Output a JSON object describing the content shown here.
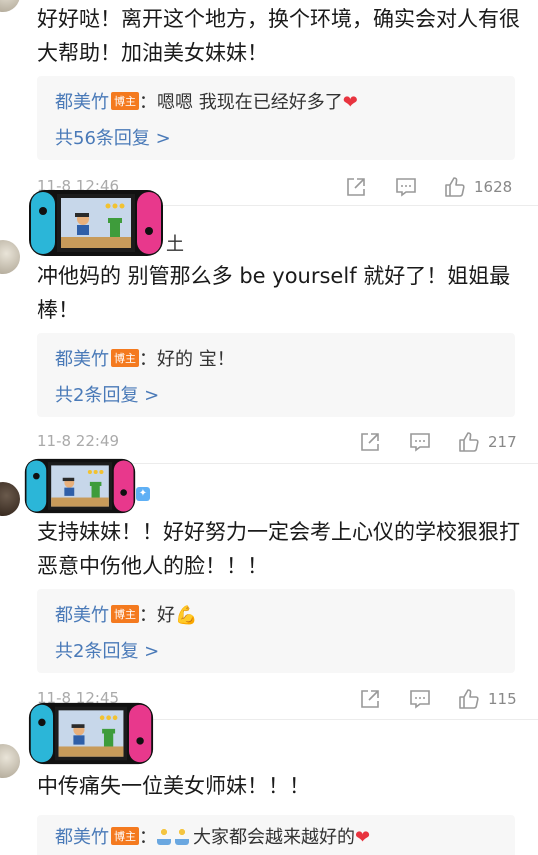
{
  "comments": [
    {
      "text": "好好哒！离开这个地方，换个环境，确实会对人有很大帮助！加油美女妹妹！",
      "reply": {
        "author": "都美竹",
        "badge": "博主",
        "sep": "：",
        "text": "嗯嗯 我现在已经好多了",
        "emoji": "❤"
      },
      "reply_count": "共56条回复 >",
      "time": "11-8 12:46",
      "likes": "1628"
    },
    {
      "username": "土",
      "text": "冲他妈的 别管那么多 be yourself 就好了！姐姐最棒！",
      "reply": {
        "author": "都美竹",
        "badge": "博主",
        "sep": "：",
        "text": "好的 宝！",
        "emoji": ""
      },
      "reply_count": "共2条回复 >",
      "time": "11-8 22:49",
      "likes": "217"
    },
    {
      "text": "支持妹妹！！好好努力一定会考上心仪的学校狠狠打恶意中伤他人的脸！！！",
      "reply": {
        "author": "都美竹",
        "badge": "博主",
        "sep": "：",
        "text": "好",
        "emoji": "💪"
      },
      "reply_count": "共2条回复 >",
      "time": "11-8 12:45",
      "likes": "115"
    },
    {
      "text": "中传痛失一位美女师妹！！！",
      "reply": {
        "author": "都美竹",
        "badge": "博主",
        "sep": "：",
        "text": "大家都会越来越好的",
        "emoji": "❤"
      }
    }
  ],
  "colors": {
    "link": "#4a7ab8",
    "badge": "#f47a1f",
    "heart": "#e8343f"
  },
  "icons": [
    "share-icon",
    "comment-icon",
    "thumbs-up-icon",
    "switch-console-sticker"
  ]
}
